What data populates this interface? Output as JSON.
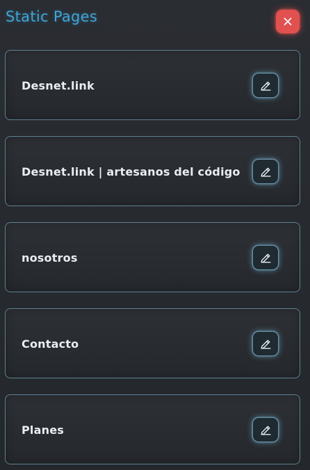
{
  "header": {
    "title": "Static Pages",
    "close_icon": "close-icon"
  },
  "colors": {
    "title": "#3fa6d8",
    "close_button": "#e0514f",
    "card_border": "#5e8294",
    "label": "#e9eef2"
  },
  "pages": [
    {
      "label": "Desnet.link",
      "icon": "pencil-icon"
    },
    {
      "label": "Desnet.link | artesanos del código",
      "icon": "pencil-icon"
    },
    {
      "label": "nosotros",
      "icon": "pencil-icon"
    },
    {
      "label": "Contacto",
      "icon": "pencil-icon"
    },
    {
      "label": "Planes",
      "icon": "pencil-icon"
    }
  ]
}
